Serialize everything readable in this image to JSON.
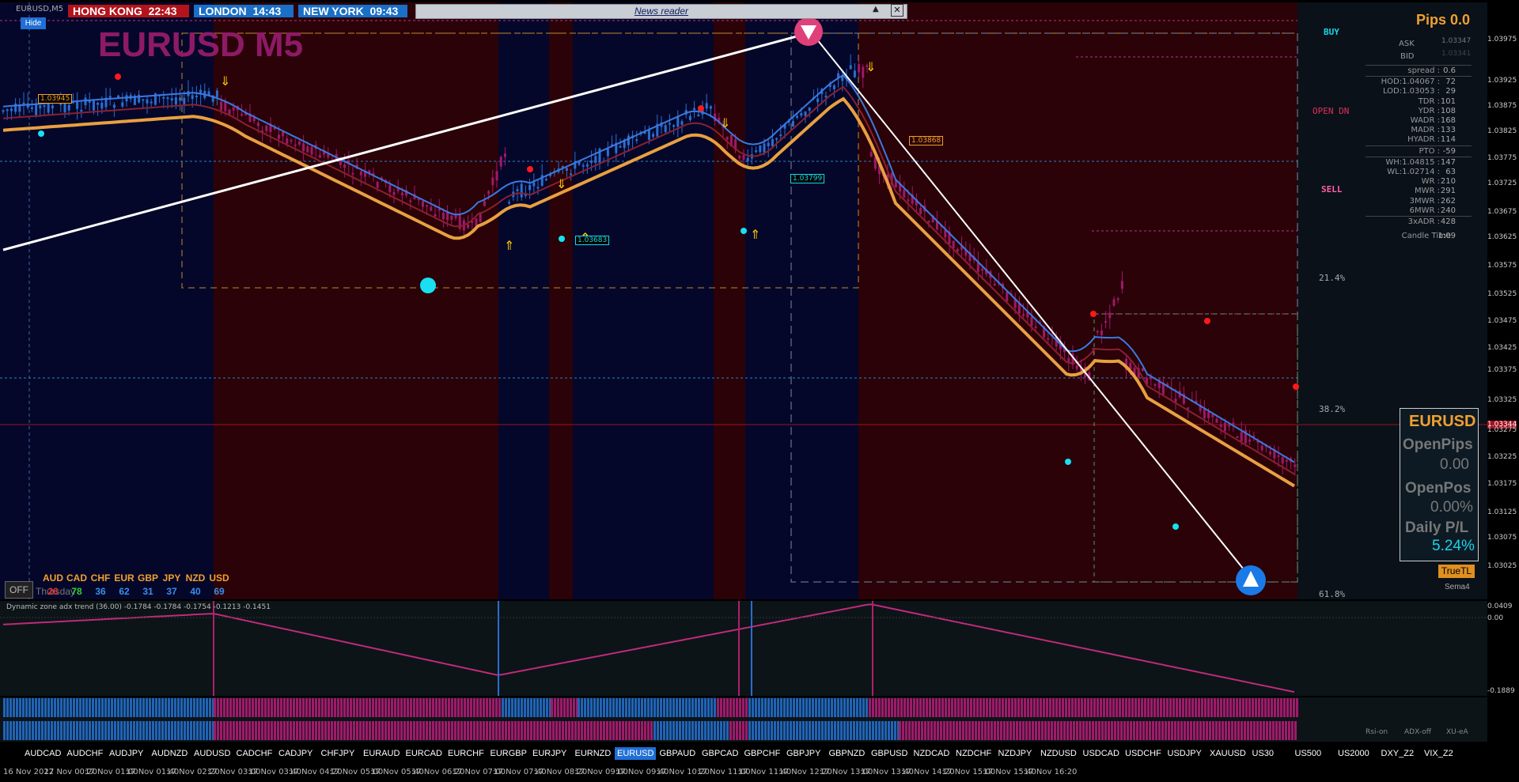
{
  "window": {
    "title": "EURUSD,M5",
    "hide_button": "Hide",
    "chart_title": "EURUSD M5"
  },
  "clocks": [
    {
      "label": "HONG KONG",
      "time": "22:43",
      "color": "#b3141c"
    },
    {
      "label": "LONDON",
      "time": "14:43",
      "color": "#1a6fc6"
    },
    {
      "label": "NEW YORK",
      "time": "09:43",
      "color": "#1a6fc6"
    }
  ],
  "news_reader": {
    "label": "News reader"
  },
  "signals": {
    "buy": "BUY",
    "open_dn": "OPEN DN",
    "sell": "SELL"
  },
  "fib_levels": [
    "21.4%",
    "38.2%",
    "61.8%"
  ],
  "price_boxes": [
    "1.03945",
    "1.03868",
    "1.03799",
    "1.03683"
  ],
  "stats": {
    "pips": "Pips 0.0",
    "ask_label": "ASK",
    "ask": "1.03347",
    "bid_label": "BID",
    "bid": "1.03341",
    "rows": [
      {
        "k": "spread :",
        "v": "0.6"
      },
      {
        "k": "HOD:1.04067 :",
        "v": "72"
      },
      {
        "k": "LOD:1.03053 :",
        "v": "29"
      },
      {
        "k": "TDR :",
        "v": "101"
      },
      {
        "k": "YDR :",
        "v": "108"
      },
      {
        "k": "WADR :",
        "v": "168"
      },
      {
        "k": "MADR :",
        "v": "133"
      },
      {
        "k": "HYADR :",
        "v": "114"
      },
      {
        "k": "PTO :",
        "v": "-59"
      },
      {
        "k": "WH:1.04815 :",
        "v": "147"
      },
      {
        "k": "WL:1.02714 :",
        "v": "63"
      },
      {
        "k": "WR :",
        "v": "210"
      },
      {
        "k": "MWR :",
        "v": "291"
      },
      {
        "k": "3MWR :",
        "v": "262"
      },
      {
        "k": "6MWR :",
        "v": "240"
      },
      {
        "k": "3xADR :",
        "v": "428"
      },
      {
        "k": "Candle Time",
        "v": "1:09"
      }
    ]
  },
  "account_box": {
    "symbol": "EURUSD",
    "open_pips_label": "OpenPips",
    "open_pips": "0.00",
    "open_pos_label": "OpenPos",
    "open_pos": "0.00%",
    "daily_pl_label": "Daily P/L",
    "daily_pl": "5.24%"
  },
  "truetl": "TrueTL",
  "sema": "Sema4",
  "off_button": "OFF",
  "currency_strength": {
    "names": [
      "AUD",
      "CAD",
      "CHF",
      "EUR",
      "GBP",
      "JPY",
      "NZD",
      "USD"
    ],
    "values": [
      "26",
      "78",
      "36",
      "62",
      "31",
      "37",
      "40",
      "69"
    ],
    "value_colors": [
      "#e03030",
      "#30d030",
      "#3a8ee8",
      "#3a8ee8",
      "#3a8ee8",
      "#3a8ee8",
      "#3a8ee8",
      "#3a8ee8"
    ],
    "day_label": "Thursday"
  },
  "price_axis": [
    "1.03975",
    "1.03925",
    "1.03875",
    "1.03825",
    "1.03775",
    "1.03725",
    "1.03675",
    "1.03625",
    "1.03575",
    "1.03525",
    "1.03475",
    "1.03425",
    "1.03375",
    "1.03344",
    "1.03325",
    "1.03275",
    "1.03225",
    "1.03175",
    "1.03125",
    "1.03075",
    "1.03025"
  ],
  "indicator": {
    "label": "Dynamic zone adx trend (36.00) -0.1784 -0.1784 -0.1754 -0.1213 -0.1451",
    "axis": [
      "0.0409",
      "0.00",
      "-0.1889"
    ]
  },
  "strip_labels": [
    "Rsi-on",
    "ADX-off",
    "XU-eA"
  ],
  "symbols": [
    "AUDCAD",
    "AUDCHF",
    "AUDJPY",
    "AUDNZD",
    "AUDUSD",
    "CADCHF",
    "CADJPY",
    "CHFJPY",
    "EURAUD",
    "EURCAD",
    "EURCHF",
    "EURGBP",
    "EURJPY",
    "EURNZD",
    "EURUSD",
    "GBPAUD",
    "GBPCAD",
    "GBPCHF",
    "GBPJPY",
    "GBPNZD",
    "GBPUSD",
    "NZDCAD",
    "NZDCHF",
    "NZDJPY",
    "NZDUSD",
    "USDCAD",
    "USDCHF",
    "USDJPY",
    "XAUUSD",
    "US30",
    "US500",
    "US2000",
    "DXY_Z2",
    "VIX_Z2"
  ],
  "active_symbol": "EURUSD",
  "time_axis": [
    "16 Nov 2022",
    "17 Nov 00:20",
    "17 Nov 01:00",
    "17 Nov 01:40",
    "17 Nov 02:20",
    "17 Nov 03:00",
    "17 Nov 03:40",
    "17 Nov 04:20",
    "17 Nov 05:00",
    "17 Nov 05:40",
    "17 Nov 06:20",
    "17 Nov 07:00",
    "17 Nov 07:40",
    "17 Nov 08:20",
    "17 Nov 09:00",
    "17 Nov 09:40",
    "17 Nov 10:20",
    "17 Nov 11:00",
    "17 Nov 11:40",
    "17 Nov 12:20",
    "17 Nov 13:00",
    "17 Nov 13:40",
    "17 Nov 14:20",
    "17 Nov 15:00",
    "17 Nov 15:40",
    "17 Nov 16:20"
  ]
}
